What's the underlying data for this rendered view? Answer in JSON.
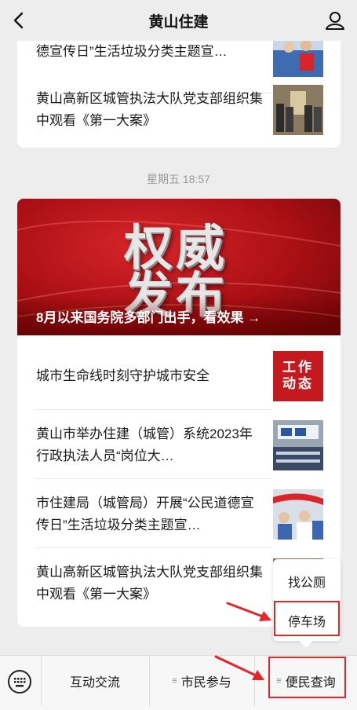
{
  "nav": {
    "title": "黄山住建"
  },
  "top_card": {
    "items": [
      {
        "title": "德宣传日”生活垃圾分类主题宣…"
      },
      {
        "title": "黄山高新区城管执法大队党支部组织集中观看《第一大案》"
      }
    ]
  },
  "timestamp": "星期五 18:57",
  "banner": {
    "line1": "权威",
    "line2": "发布",
    "caption": "8月以来国务院多部门出手，看效果 →"
  },
  "articles": [
    {
      "title": "城市生命线时刻守护城市安全",
      "thumb_text": "工作动态"
    },
    {
      "title": "黄山市举办住建（城管）系统2023年行政执法人员“岗位大…"
    },
    {
      "title": "市住建局（城管局）开展“公民道德宣传日”生活垃圾分类主题宣…"
    },
    {
      "title": "黄山高新区城管执法大队党支部组织集中观看《第一大案》"
    }
  ],
  "popup": {
    "items": [
      "找公厕",
      "停车场"
    ]
  },
  "tabbar": {
    "tabs": [
      "互动交流",
      "市民参与",
      "便民查询"
    ]
  },
  "colors": {
    "highlight": "#e8232a",
    "banner": "#c8161d"
  }
}
